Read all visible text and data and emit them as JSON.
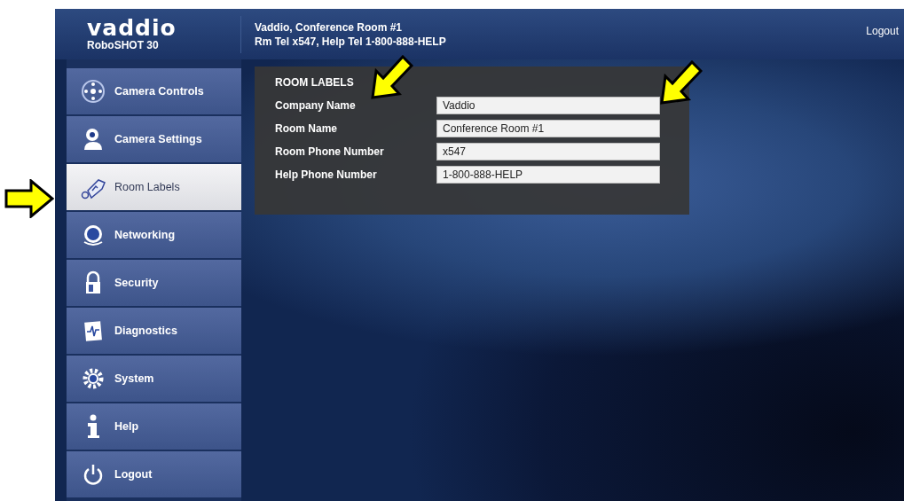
{
  "header": {
    "logo": "vaddio",
    "model": "RoboSHOT 30",
    "title_line1": "Vaddio, Conference Room #1",
    "title_line2": "Rm Tel x547, Help Tel 1-800-888-HELP",
    "logout": "Logout"
  },
  "sidebar": {
    "items": [
      {
        "label": "Camera Controls",
        "selected": false
      },
      {
        "label": "Camera Settings",
        "selected": false
      },
      {
        "label": "Room Labels",
        "selected": true
      },
      {
        "label": "Networking",
        "selected": false
      },
      {
        "label": "Security",
        "selected": false
      },
      {
        "label": "Diagnostics",
        "selected": false
      },
      {
        "label": "System",
        "selected": false
      },
      {
        "label": "Help",
        "selected": false
      },
      {
        "label": "Logout",
        "selected": false
      }
    ]
  },
  "panel": {
    "title": "ROOM LABELS",
    "fields": [
      {
        "label": "Company Name",
        "value": "Vaddio"
      },
      {
        "label": "Room Name",
        "value": "Conference Room #1"
      },
      {
        "label": "Room Phone Number",
        "value": "x547"
      },
      {
        "label": "Help Phone Number",
        "value": "1-800-888-HELP"
      }
    ]
  }
}
